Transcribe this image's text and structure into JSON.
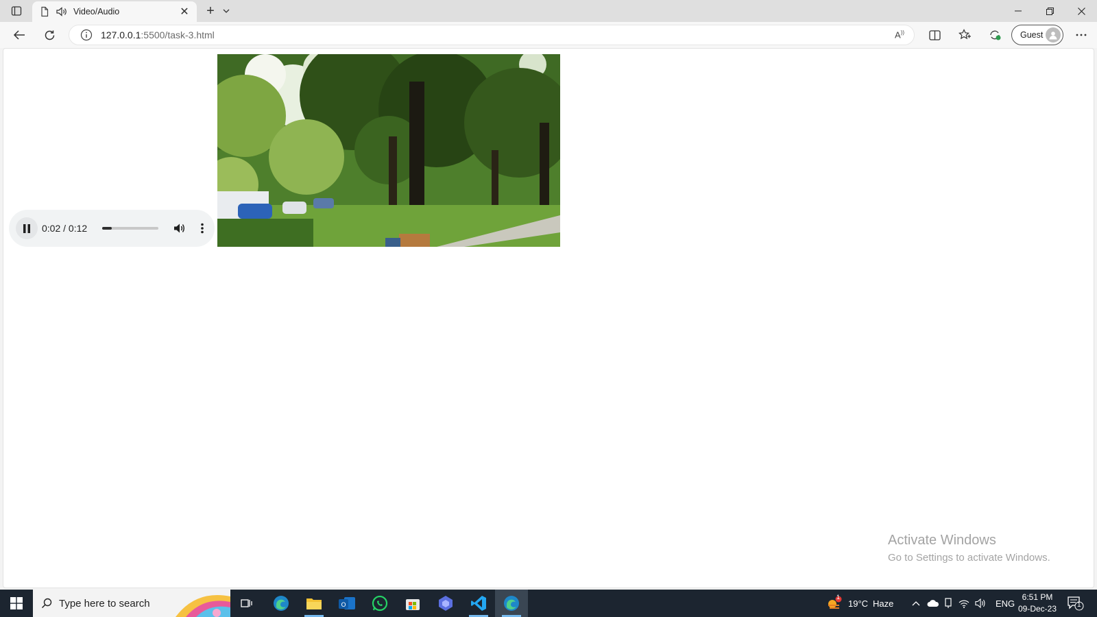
{
  "browser": {
    "tab": {
      "title": "Video/Audio"
    },
    "address": {
      "host": "127.0.0.1",
      "rest": ":5500/task-3.html"
    },
    "profile": {
      "label": "Guest"
    }
  },
  "page": {
    "audio_player": {
      "state": "playing",
      "time_display": "0:02 / 0:12",
      "progress": 0.17
    },
    "video": {
      "description_icon": "park-trees-video-frame"
    }
  },
  "watermark": {
    "line1": "Activate Windows",
    "line2": "Go to Settings to activate Windows."
  },
  "taskbar": {
    "search_placeholder": "Type here to search",
    "weather": {
      "temp": "19°C",
      "condition": "Haze",
      "badge": "1"
    },
    "language": "ENG",
    "time": "6:51 PM",
    "date": "09-Dec-23",
    "notification_count": "1"
  },
  "colors": {
    "taskbar": "#1c2530",
    "accent": "#76b9ed",
    "player_bg": "#f1f3f4"
  }
}
